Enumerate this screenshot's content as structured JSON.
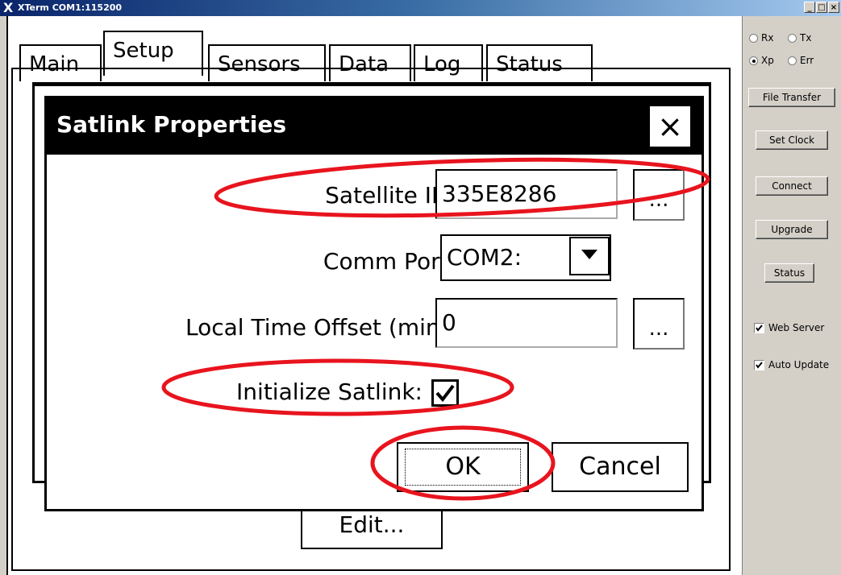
{
  "window": {
    "title": "XTerm COM1:115200",
    "logo": "X",
    "btn_min": "_",
    "btn_max": "□",
    "btn_close": "×"
  },
  "tabs": [
    {
      "label": "Main"
    },
    {
      "label": "Setup"
    },
    {
      "label": "Sensors"
    },
    {
      "label": "Data"
    },
    {
      "label": "Log"
    },
    {
      "label": "Status"
    }
  ],
  "active_tab": "Setup",
  "edit_button": "Edit...",
  "dialog": {
    "title": "Satlink Properties",
    "close": "×",
    "satellite_id_label": "Satellite ID:",
    "satellite_id_value": "335E8286",
    "comm_port_label": "Comm Port:",
    "comm_port_value": "COM2:",
    "offset_label": "Local Time Offset (min):",
    "offset_value": "0",
    "browse": "...",
    "init_label": "Initialize Satlink:",
    "init_checked": true,
    "ok": "OK",
    "cancel": "Cancel"
  },
  "side": {
    "radios": [
      {
        "label": "Rx",
        "checked": false
      },
      {
        "label": "Tx",
        "checked": false
      },
      {
        "label": "Xp",
        "checked": true
      },
      {
        "label": "Err",
        "checked": false
      }
    ],
    "buttons": [
      "File Transfer",
      "Set Clock",
      "Connect",
      "Upgrade",
      "Status"
    ],
    "checkboxes": [
      {
        "label": "Web Server",
        "checked": true
      },
      {
        "label": "Auto Update",
        "checked": true
      }
    ]
  },
  "colors": {
    "annotation": "#e8141e",
    "titlebar": "#0a246a"
  }
}
